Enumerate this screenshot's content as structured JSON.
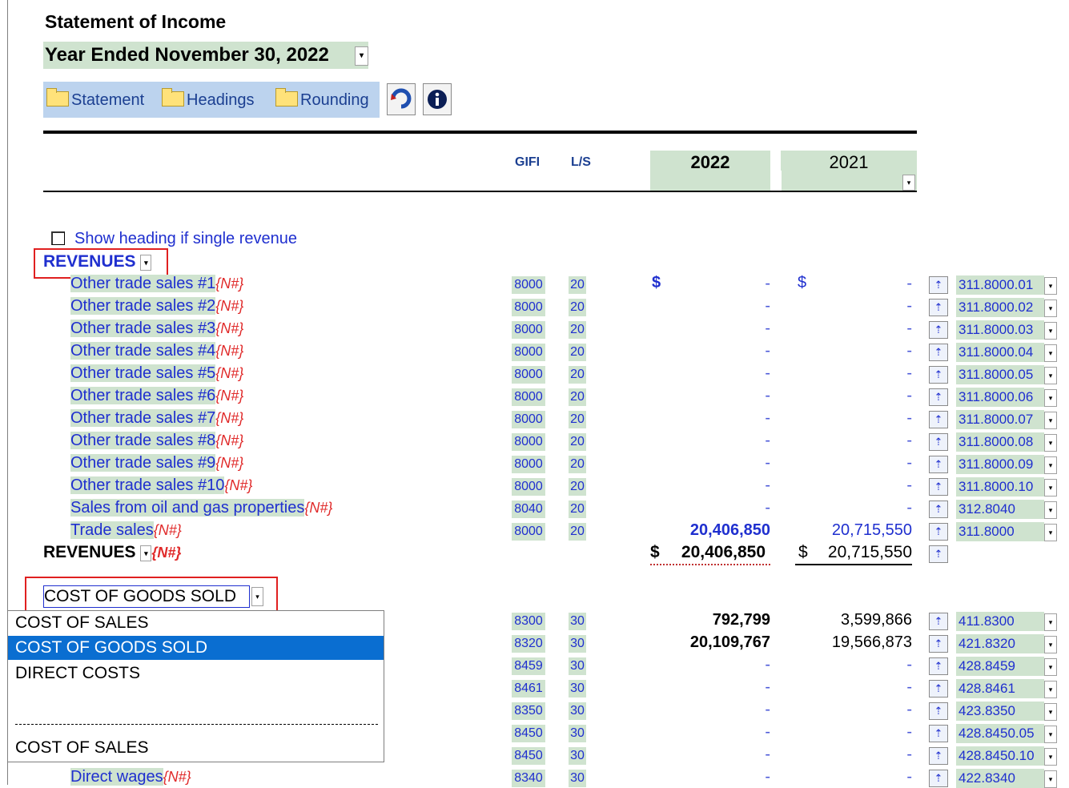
{
  "header": {
    "title": "Statement of Income",
    "period": "Year Ended November 30, 2022",
    "toolbar": {
      "statement": "Statement",
      "headings": "Headings",
      "rounding": "Rounding"
    }
  },
  "columns": {
    "gifi": "GIFI",
    "ls": "L/S",
    "year_current": "2022",
    "year_prior": "2021"
  },
  "show_heading_label": "Show heading if single revenue",
  "revenues": {
    "heading": "REVENUES",
    "rows": [
      {
        "label": "Other trade sales #1",
        "tag": "{N#}",
        "gifi": "8000",
        "ls": "20",
        "v2022": "-",
        "v2021": "-",
        "acct": "311.8000.01"
      },
      {
        "label": "Other trade sales #2",
        "tag": "{N#}",
        "gifi": "8000",
        "ls": "20",
        "v2022": "-",
        "v2021": "-",
        "acct": "311.8000.02"
      },
      {
        "label": "Other trade sales #3",
        "tag": "{N#}",
        "gifi": "8000",
        "ls": "20",
        "v2022": "-",
        "v2021": "-",
        "acct": "311.8000.03"
      },
      {
        "label": "Other trade sales #4",
        "tag": "{N#}",
        "gifi": "8000",
        "ls": "20",
        "v2022": "-",
        "v2021": "-",
        "acct": "311.8000.04"
      },
      {
        "label": "Other trade sales #5",
        "tag": "{N#}",
        "gifi": "8000",
        "ls": "20",
        "v2022": "-",
        "v2021": "-",
        "acct": "311.8000.05"
      },
      {
        "label": "Other trade sales #6",
        "tag": "{N#}",
        "gifi": "8000",
        "ls": "20",
        "v2022": "-",
        "v2021": "-",
        "acct": "311.8000.06"
      },
      {
        "label": "Other trade sales #7",
        "tag": "{N#}",
        "gifi": "8000",
        "ls": "20",
        "v2022": "-",
        "v2021": "-",
        "acct": "311.8000.07"
      },
      {
        "label": "Other trade sales #8",
        "tag": "{N#}",
        "gifi": "8000",
        "ls": "20",
        "v2022": "-",
        "v2021": "-",
        "acct": "311.8000.08"
      },
      {
        "label": "Other trade sales #9",
        "tag": "{N#}",
        "gifi": "8000",
        "ls": "20",
        "v2022": "-",
        "v2021": "-",
        "acct": "311.8000.09"
      },
      {
        "label": "Other trade sales #10",
        "tag": "{N#}",
        "gifi": "8000",
        "ls": "20",
        "v2022": "-",
        "v2021": "-",
        "acct": "311.8000.10"
      },
      {
        "label": "Sales from oil and gas properties",
        "tag": "{N#}",
        "gifi": "8040",
        "ls": "20",
        "v2022": "-",
        "v2021": "-",
        "acct": "312.8040"
      },
      {
        "label": "Trade sales",
        "tag": "{N#}",
        "gifi": "8000",
        "ls": "20",
        "v2022": "20,406,850",
        "v2021": "20,715,550",
        "acct": "311.8000"
      }
    ],
    "currency": "$",
    "total_label": "REVENUES",
    "total_tag": "{N#}",
    "total_2022": "20,406,850",
    "total_2021": "20,715,550"
  },
  "cogs": {
    "selected": "COST OF GOODS SOLD",
    "options": [
      "COST OF SALES",
      "COST OF GOODS SOLD",
      "DIRECT COSTS",
      "",
      "COST OF SALES"
    ],
    "rows": [
      {
        "gifi": "8300",
        "ls": "30",
        "v2022": "792,799",
        "v2021": "3,599,866",
        "acct": "411.8300"
      },
      {
        "gifi": "8320",
        "ls": "30",
        "v2022": "20,109,767",
        "v2021": "19,566,873",
        "acct": "421.8320"
      },
      {
        "gifi": "8459",
        "ls": "30",
        "v2022": "-",
        "v2021": "-",
        "acct": "428.8459"
      },
      {
        "gifi": "8461",
        "ls": "30",
        "v2022": "-",
        "v2021": "-",
        "acct": "428.8461"
      },
      {
        "gifi": "8350",
        "ls": "30",
        "v2022": "-",
        "v2021": "-",
        "acct": "423.8350"
      },
      {
        "gifi": "8450",
        "ls": "30",
        "v2022": "-",
        "v2021": "-",
        "acct": "428.8450.05"
      },
      {
        "gifi": "8450",
        "ls": "30",
        "v2022": "-",
        "v2021": "-",
        "acct": "428.8450.10"
      },
      {
        "label": "Direct wages",
        "tag": "{N#}",
        "gifi": "8340",
        "ls": "30",
        "v2022": "-",
        "v2021": "-",
        "acct": "422.8340"
      }
    ]
  }
}
